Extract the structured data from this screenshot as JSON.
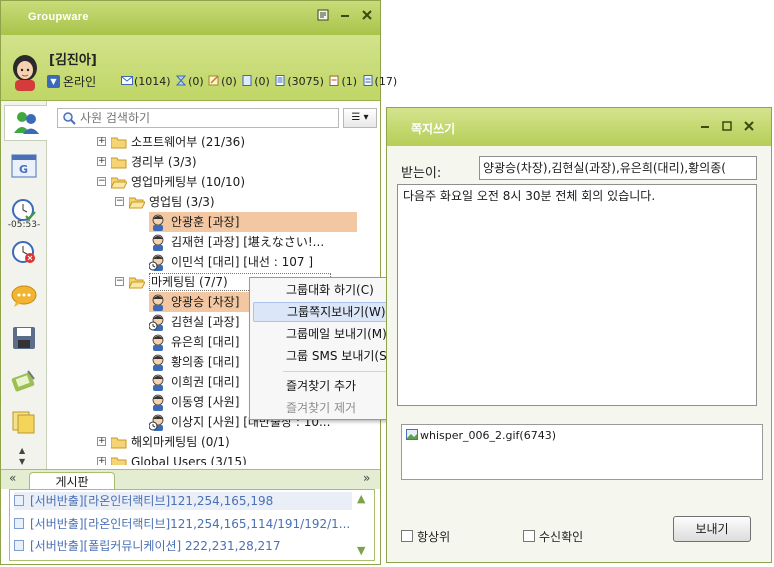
{
  "app": {
    "title": "Groupware"
  },
  "user": {
    "name": "[김진아]",
    "status": "온라인"
  },
  "counters": [
    {
      "icon": "mail-icon",
      "value": "(1014)"
    },
    {
      "icon": "hourglass-icon",
      "value": "(0)"
    },
    {
      "icon": "note-icon",
      "value": "(0)"
    },
    {
      "icon": "doc-icon",
      "value": "(0)"
    },
    {
      "icon": "page-icon",
      "value": "(3075)"
    },
    {
      "icon": "clipboard-icon",
      "value": "(1)"
    },
    {
      "icon": "sheet-icon",
      "value": "(17)"
    }
  ],
  "sidebar": {
    "time": "-05:53-"
  },
  "search": {
    "placeholder": "사원 검색하기"
  },
  "tree": {
    "items": [
      {
        "label": "소프트웨어부 (21/36)"
      },
      {
        "label": "경리부 (3/3)"
      },
      {
        "label": "영업마케팅부 (10/10)"
      },
      {
        "label": "영업팀 (3/3)"
      },
      {
        "label": "안광훈 [과장]"
      },
      {
        "label": "김재현 [과장] [堪えなさい!..."
      },
      {
        "label": "이민석 [대리] [내선 : 107 ]"
      },
      {
        "label": "마케팅팀 (7/7)"
      },
      {
        "label": "양광승 [차장]"
      },
      {
        "label": "김현실 [과장]"
      },
      {
        "label": "유은희 [대리]"
      },
      {
        "label": "황의종 [대리]"
      },
      {
        "label": "이희권 [대리]"
      },
      {
        "label": "이동영 [사원]"
      },
      {
        "label": "이상지 [사원] [대만출장 : 10..."
      },
      {
        "label": "해외마케팅팀 (0/1)"
      },
      {
        "label": "Global Users (3/15)"
      }
    ]
  },
  "context_menu": {
    "items": [
      {
        "label": "그룹대화 하기(C)"
      },
      {
        "label": "그룹쪽지보내기(W)"
      },
      {
        "label": "그룹메일 보내기(M)"
      },
      {
        "label": "그룹 SMS 보내기(S)"
      },
      {
        "label": "즐겨찾기 추가"
      },
      {
        "label": "즐겨찾기 제거"
      }
    ]
  },
  "board": {
    "tab": "게시판",
    "rows": [
      {
        "text": "[서버반출][라온인터랙티브]121,254,165,198"
      },
      {
        "text": "[서버반출][라온인터랙티브]121,254,165,114/191/192/1..."
      },
      {
        "text": "[서버반출][폴립커뮤니케이션] 222,231,28,217"
      }
    ]
  },
  "compose": {
    "title": "쪽지쓰기",
    "to_label": "받는이:",
    "recipients": "양광승(차장),김현실(과장),유은희(대리),황의종(",
    "message": "다음주 화요일 오전 8시 30분 전체 회의 있습니다.",
    "attachment": "whisper_006_2.gif(6743)",
    "always_on_top": "항상위",
    "read_receipt": "수신확인",
    "send": "보내기"
  },
  "colors": {
    "title_bar": "#b6cd57",
    "highlight": "#f4c7a3",
    "link": "#4a70b5"
  }
}
